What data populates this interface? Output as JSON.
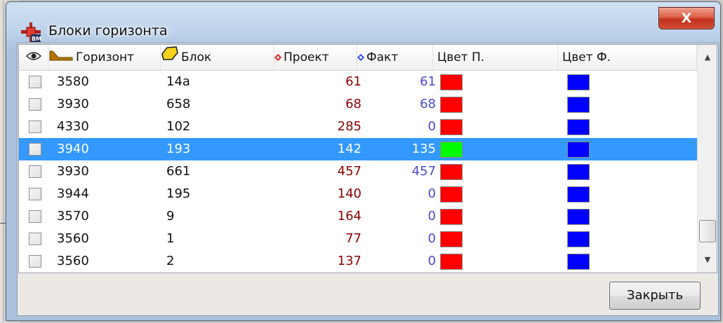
{
  "window": {
    "title": "Блоки горизонта",
    "close_glyph": "X",
    "app_icon": "bm-crosshair-icon"
  },
  "table": {
    "columns": {
      "visibility_icon": "eye-icon",
      "horizon": "Горизонт",
      "block": "Блок",
      "project": "Проект",
      "fact": "Факт",
      "color_project": "Цвет П.",
      "color_fact": "Цвет Ф."
    },
    "rows": [
      {
        "horizon": "3580",
        "block": "14а",
        "project": "61",
        "fact": "61",
        "color_project": "#ff0000",
        "color_fact": "#0000ff",
        "checked": false,
        "selected": false
      },
      {
        "horizon": "3930",
        "block": "658",
        "project": "68",
        "fact": "68",
        "color_project": "#ff0000",
        "color_fact": "#0000ff",
        "checked": false,
        "selected": false
      },
      {
        "horizon": "4330",
        "block": "102",
        "project": "285",
        "fact": "0",
        "color_project": "#ff0000",
        "color_fact": "#0000ff",
        "checked": false,
        "selected": false
      },
      {
        "horizon": "3940",
        "block": "193",
        "project": "142",
        "fact": "135",
        "color_project": "#00ff00",
        "color_fact": "#0000ff",
        "checked": false,
        "selected": true
      },
      {
        "horizon": "3930",
        "block": "661",
        "project": "457",
        "fact": "457",
        "color_project": "#ff0000",
        "color_fact": "#0000ff",
        "checked": false,
        "selected": false
      },
      {
        "horizon": "3944",
        "block": "195",
        "project": "140",
        "fact": "0",
        "color_project": "#ff0000",
        "color_fact": "#0000ff",
        "checked": false,
        "selected": false
      },
      {
        "horizon": "3570",
        "block": "9",
        "project": "164",
        "fact": "0",
        "color_project": "#ff0000",
        "color_fact": "#0000ff",
        "checked": false,
        "selected": false
      },
      {
        "horizon": "3560",
        "block": "1",
        "project": "77",
        "fact": "0",
        "color_project": "#ff0000",
        "color_fact": "#0000ff",
        "checked": false,
        "selected": false
      },
      {
        "horizon": "3560",
        "block": "2",
        "project": "137",
        "fact": "0",
        "color_project": "#ff0000",
        "color_fact": "#0000ff",
        "checked": false,
        "selected": false
      }
    ]
  },
  "footer": {
    "close_button": "Закрыть"
  },
  "colors": {
    "selection": "#3399ff",
    "project_text": "#8b0000",
    "fact_text": "#4a4ad0"
  }
}
